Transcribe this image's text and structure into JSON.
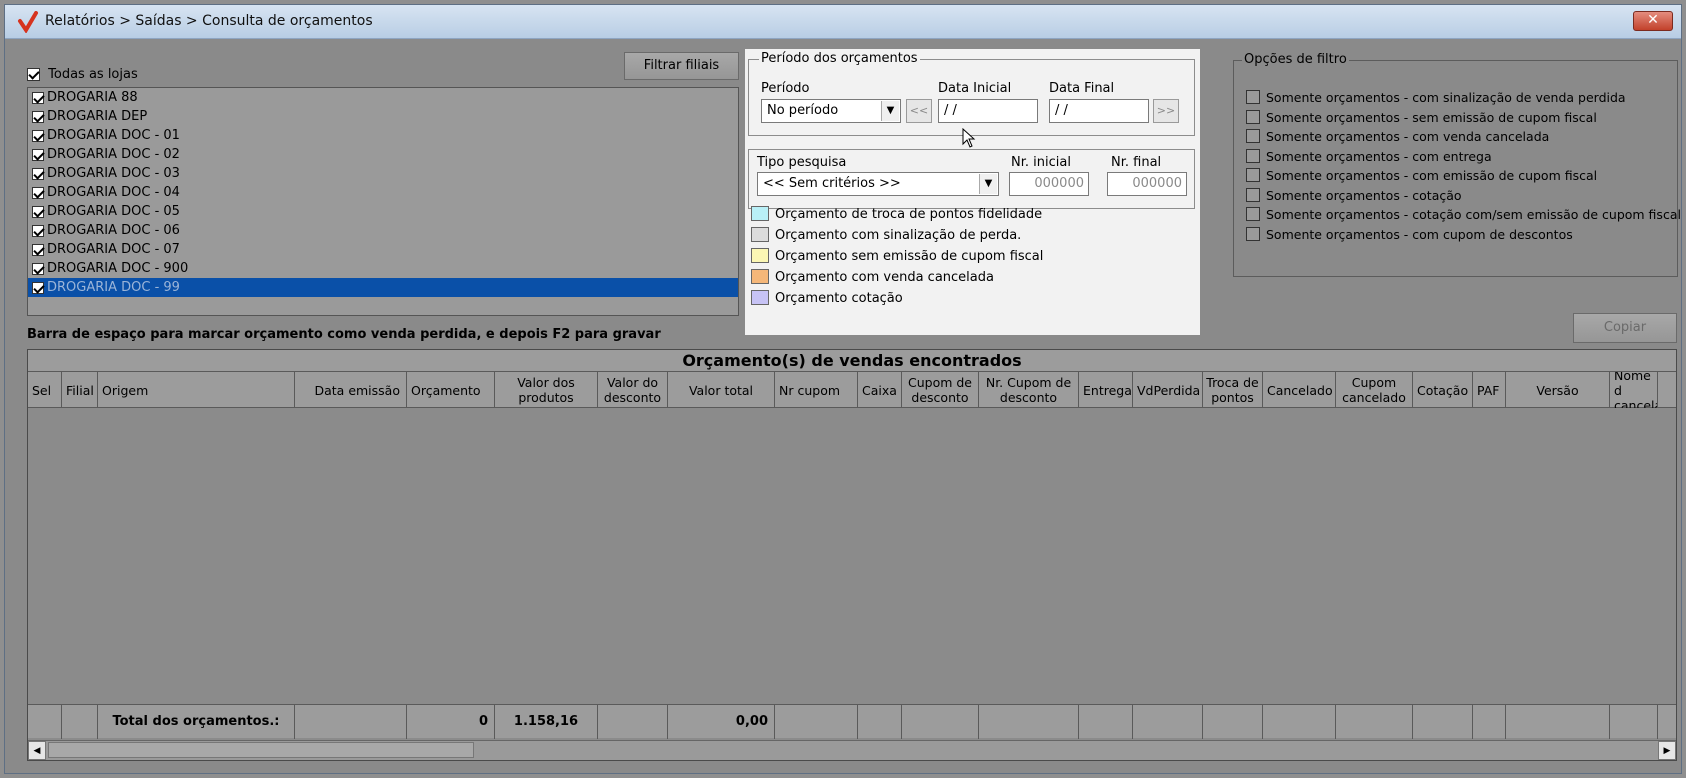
{
  "window": {
    "title": "Relatórios > Saídas > Consulta de orçamentos",
    "close_label": "✕"
  },
  "stores": {
    "all_label": "Todas as lojas",
    "filter_button": "Filtrar filiais",
    "items": [
      {
        "label": "DROGARIA 88",
        "checked": true
      },
      {
        "label": "DROGARIA DEP",
        "checked": true
      },
      {
        "label": "DROGARIA DOC - 01",
        "checked": true
      },
      {
        "label": "DROGARIA DOC - 02",
        "checked": true
      },
      {
        "label": "DROGARIA DOC - 03",
        "checked": true
      },
      {
        "label": "DROGARIA DOC - 04",
        "checked": true
      },
      {
        "label": "DROGARIA DOC - 05",
        "checked": true
      },
      {
        "label": "DROGARIA DOC - 06",
        "checked": true
      },
      {
        "label": "DROGARIA DOC - 07",
        "checked": true
      },
      {
        "label": "DROGARIA DOC - 900",
        "checked": true
      },
      {
        "label": "DROGARIA DOC - 99",
        "checked": true,
        "selected": true
      }
    ]
  },
  "periodo": {
    "group_title": "Período dos orçamentos",
    "period_label": "Período",
    "period_value": "No período",
    "start_label": "Data Inicial",
    "start_value": "/ /",
    "end_label": "Data Final",
    "end_value": "/ /",
    "prev_label": "<<",
    "next_label": ">>"
  },
  "pesquisa": {
    "type_label": "Tipo pesquisa",
    "type_value": "<< Sem critérios >>",
    "nr_inicial_label": "Nr. inicial",
    "nr_inicial_value": "000000",
    "nr_final_label": "Nr. final",
    "nr_final_value": "000000"
  },
  "legend": [
    {
      "label": "Orçamento de troca de pontos fidelidade",
      "color": "#b9f0f7"
    },
    {
      "label": "Orçamento com sinalização de perda.",
      "color": "#dcdcdc"
    },
    {
      "label": "Orçamento sem emissão de cupom fiscal",
      "color": "#fbf7b4"
    },
    {
      "label": "Orçamento com venda cancelada",
      "color": "#f5b779"
    },
    {
      "label": "Orçamento cotação",
      "color": "#c7c3f5"
    }
  ],
  "filtros": {
    "group_title": "Opções de filtro",
    "items": [
      "Somente orçamentos - com sinalização de venda perdida",
      "Somente orçamentos - sem emissão de cupom fiscal",
      "Somente orçamentos - com venda cancelada",
      "Somente orçamentos - com entrega",
      "Somente orçamentos - com emissão de cupom fiscal",
      "Somente orçamentos - cotação",
      "Somente orçamentos - cotação com/sem emissão de cupom fiscal",
      "Somente orçamentos - com cupom de descontos"
    ]
  },
  "copy_button": "Copiar",
  "hint": "Barra de espaço para marcar orçamento como venda perdida, e depois F2 para gravar",
  "grid": {
    "caption": "Orçamento(s) de vendas encontrados",
    "columns": [
      "Sel",
      "Filial",
      "Origem",
      "Data emissão",
      "Orçamento",
      "Valor dos produtos",
      "Valor do desconto",
      "Valor total",
      "Nr cupom",
      "Caixa",
      "Cupom de desconto",
      "Nr. Cupom de desconto",
      "Entrega",
      "VdPerdida",
      "Troca de pontos",
      "Cancelado",
      "Cupom cancelado",
      "Cotação",
      "PAF",
      "Versão",
      "Nome d cancela"
    ],
    "totals": {
      "label": "Total dos orçamentos.:",
      "orcamento": "0",
      "valor_produtos": "1.158,16",
      "valor_total": "0,00"
    }
  }
}
